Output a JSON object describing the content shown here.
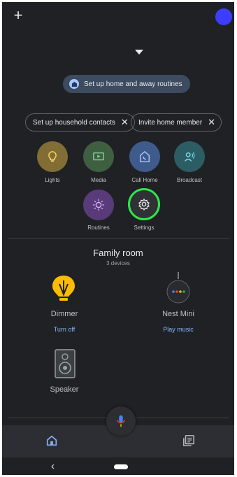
{
  "header": {
    "add_icon": "plus-icon",
    "avatar_color": "#3d3dff"
  },
  "banner": {
    "label": "Set up home and away routines"
  },
  "suggestions": [
    {
      "label": "Set up household contacts"
    },
    {
      "label": "Invite home member"
    }
  ],
  "shortcuts": [
    {
      "label": "Lights",
      "icon": "bulb-icon",
      "color": "#826e35"
    },
    {
      "label": "Media",
      "icon": "media-icon",
      "color": "#3e6041"
    },
    {
      "label": "Call Home",
      "icon": "call-home-icon",
      "color": "#3e5b8c"
    },
    {
      "label": "Broadcast",
      "icon": "broadcast-icon",
      "color": "#2d5d64"
    },
    {
      "label": "Routines",
      "icon": "routines-icon",
      "color": "#5a3b7a"
    },
    {
      "label": "Settings",
      "icon": "gear-icon",
      "color": "#303134"
    }
  ],
  "room": {
    "name": "Family room",
    "count": "3 devices",
    "devices": [
      {
        "name": "Dimmer",
        "action": "Turn off",
        "icon": "bulb-icon"
      },
      {
        "name": "Nest Mini",
        "action": "Play music",
        "icon": "nest-mini-icon"
      },
      {
        "name": "Speaker",
        "action": "",
        "icon": "speaker-icon"
      }
    ]
  },
  "colors": {
    "background": "#202124",
    "accent": "#8ab4f8",
    "highlight": "#2ee64a"
  }
}
